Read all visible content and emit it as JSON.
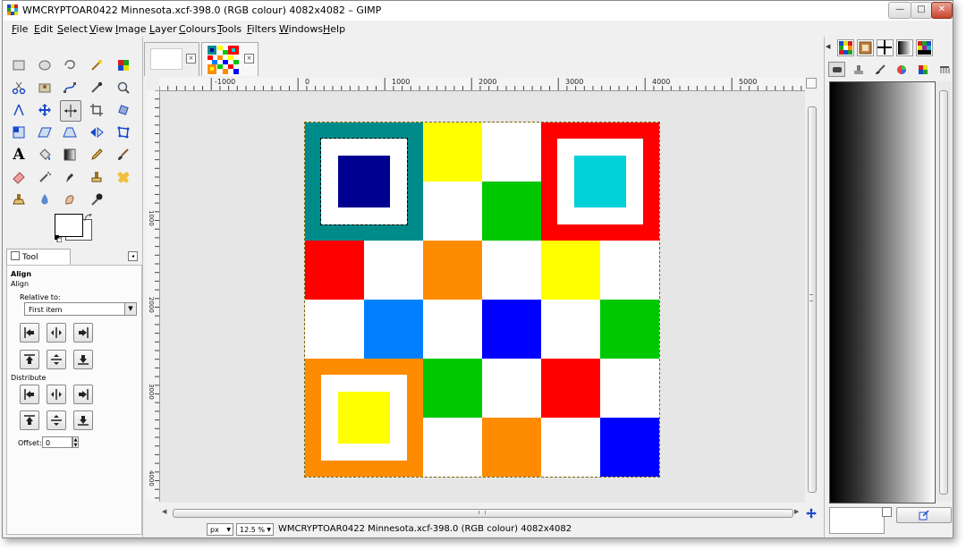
{
  "window": {
    "title": "WMCRYPTOAR0422 Minnesota.xcf-398.0 (RGB colour) 4082x4082 – GIMP",
    "minimize": "—",
    "maximize": "□",
    "close": "✕"
  },
  "menu": [
    {
      "key": "F",
      "rest": "ile"
    },
    {
      "key": "E",
      "rest": "dit"
    },
    {
      "key": "S",
      "rest": "elect"
    },
    {
      "key": "V",
      "rest": "iew"
    },
    {
      "key": "I",
      "rest": "mage"
    },
    {
      "key": "L",
      "rest": "ayer"
    },
    {
      "key": "C",
      "rest": "olours"
    },
    {
      "key": "T",
      "rest": "ools"
    },
    {
      "key": "F",
      "rest": "ilters"
    },
    {
      "key": "W",
      "rest": "indows"
    },
    {
      "key": "H",
      "rest": "elp"
    }
  ],
  "tool_options": {
    "tab_label": "Tool Options",
    "title": "Align",
    "subtitle": "Align",
    "relative_to_label": "Relative to:",
    "relative_to_value": "First item",
    "distribute_label": "Distribute",
    "offset_label": "Offset:",
    "offset_value": "0"
  },
  "ruler": {
    "h_labels": [
      "-1000",
      "0",
      "1000",
      "2000",
      "3000",
      "4000",
      "5000"
    ],
    "v_labels": [
      "1000",
      "2000",
      "3000",
      "4000"
    ]
  },
  "status": {
    "unit": "px",
    "zoom": "12.5 %",
    "text": "WMCRYPTOAR0422 Minnesota.xcf-398.0 (RGB colour) 4082x4082"
  },
  "colors": {
    "teal": "#008b8b",
    "navy": "#000090",
    "yellow": "#ffff00",
    "green": "#00c800",
    "red": "#ff0000",
    "cyan": "#00d0d8",
    "orange": "#ff8c00",
    "azure": "#0080ff",
    "blue": "#0000ff",
    "white": "#ffffff"
  },
  "grid": {
    "rows": [
      [
        "teal",
        "teal",
        "yellow",
        "white",
        "red",
        "red"
      ],
      [
        "teal",
        "teal",
        "white",
        "green",
        "red",
        "red"
      ],
      [
        "red",
        "white",
        "orange",
        "white",
        "yellow",
        "white"
      ],
      [
        "white",
        "azure",
        "white",
        "blue",
        "white",
        "green"
      ],
      [
        "orange",
        "orange",
        "green",
        "white",
        "red",
        "white"
      ],
      [
        "orange",
        "orange",
        "white",
        "orange",
        "white",
        "blue"
      ]
    ],
    "nested_squares": [
      {
        "row": 0,
        "col": 0,
        "outer": "teal",
        "inner": "navy"
      },
      {
        "row": 0,
        "col": 4,
        "outer": "red",
        "inner": "cyan"
      },
      {
        "row": 4,
        "col": 0,
        "outer": "orange",
        "inner": "yellow"
      }
    ]
  }
}
